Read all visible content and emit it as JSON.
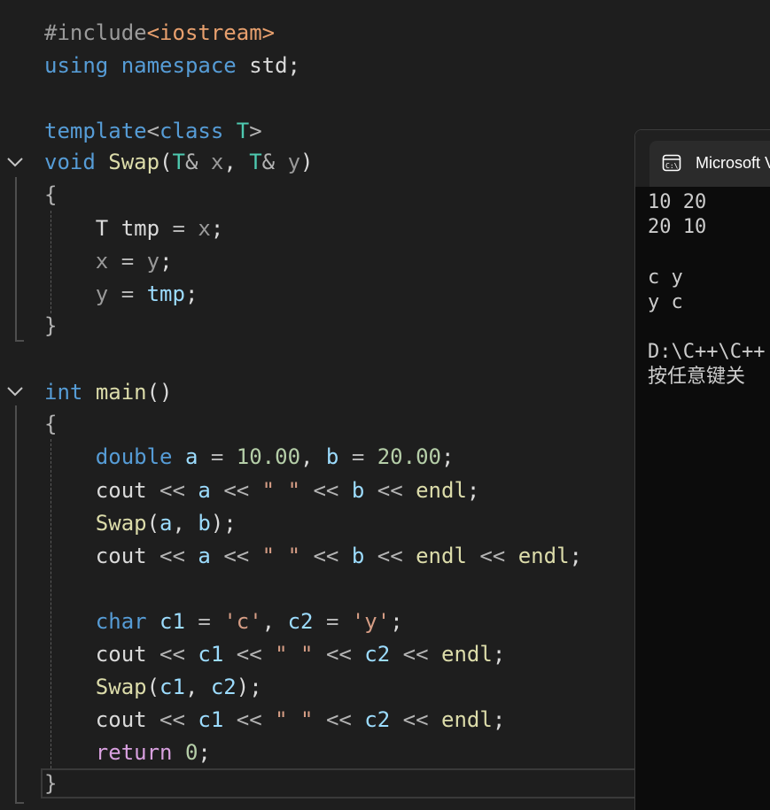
{
  "colors": {
    "editor_bg": "#1e1e1e",
    "keyword": "#569cd6",
    "type": "#4ec9b0",
    "function": "#dcdcaa",
    "variable": "#9cdcfe",
    "parameter": "#9a9a9a",
    "number": "#b5cea8",
    "string": "#d69d85",
    "control": "#d8a0df",
    "console_bg": "#0c0c0c",
    "console_text": "#cccccc"
  },
  "editor": {
    "lines": [
      [
        {
          "c": "t-pp",
          "t": "#include"
        },
        {
          "c": "t-inc",
          "t": "<iostream>"
        }
      ],
      [
        {
          "c": "t-kw",
          "t": "using namespace"
        },
        {
          "c": "t-def",
          "t": " std;"
        }
      ],
      [],
      [
        {
          "c": "t-kw",
          "t": "template"
        },
        {
          "c": "t-op",
          "t": "<"
        },
        {
          "c": "t-kw",
          "t": "class"
        },
        {
          "c": "t-def",
          "t": " "
        },
        {
          "c": "t-ty",
          "t": "T"
        },
        {
          "c": "t-op",
          "t": ">"
        }
      ],
      [
        {
          "c": "t-kw",
          "t": "void"
        },
        {
          "c": "t-def",
          "t": " "
        },
        {
          "c": "t-fn",
          "t": "Swap"
        },
        {
          "c": "t-def",
          "t": "("
        },
        {
          "c": "t-ty",
          "t": "T"
        },
        {
          "c": "t-op",
          "t": "&"
        },
        {
          "c": "t-def",
          "t": " "
        },
        {
          "c": "t-par",
          "t": "x"
        },
        {
          "c": "t-def",
          "t": ", "
        },
        {
          "c": "t-ty",
          "t": "T"
        },
        {
          "c": "t-op",
          "t": "&"
        },
        {
          "c": "t-def",
          "t": " "
        },
        {
          "c": "t-par",
          "t": "y"
        },
        {
          "c": "t-def",
          "t": ")"
        }
      ],
      [
        {
          "c": "t-op",
          "t": "{"
        }
      ],
      [
        {
          "c": "t-def",
          "t": "    T tmp "
        },
        {
          "c": "t-op",
          "t": "="
        },
        {
          "c": "t-def",
          "t": " "
        },
        {
          "c": "t-par",
          "t": "x"
        },
        {
          "c": "t-def",
          "t": ";"
        }
      ],
      [
        {
          "c": "t-def",
          "t": "    "
        },
        {
          "c": "t-par",
          "t": "x"
        },
        {
          "c": "t-def",
          "t": " "
        },
        {
          "c": "t-op",
          "t": "="
        },
        {
          "c": "t-def",
          "t": " "
        },
        {
          "c": "t-par",
          "t": "y"
        },
        {
          "c": "t-def",
          "t": ";"
        }
      ],
      [
        {
          "c": "t-def",
          "t": "    "
        },
        {
          "c": "t-par",
          "t": "y"
        },
        {
          "c": "t-def",
          "t": " "
        },
        {
          "c": "t-op",
          "t": "="
        },
        {
          "c": "t-def",
          "t": " "
        },
        {
          "c": "t-var",
          "t": "tmp"
        },
        {
          "c": "t-def",
          "t": ";"
        }
      ],
      [
        {
          "c": "t-op",
          "t": "}"
        }
      ],
      [],
      [
        {
          "c": "t-kw",
          "t": "int"
        },
        {
          "c": "t-def",
          "t": " "
        },
        {
          "c": "t-fn",
          "t": "main"
        },
        {
          "c": "t-def",
          "t": "()"
        }
      ],
      [
        {
          "c": "t-op",
          "t": "{"
        }
      ],
      [
        {
          "c": "t-def",
          "t": "    "
        },
        {
          "c": "t-kw",
          "t": "double"
        },
        {
          "c": "t-def",
          "t": " "
        },
        {
          "c": "t-var",
          "t": "a"
        },
        {
          "c": "t-def",
          "t": " "
        },
        {
          "c": "t-op",
          "t": "="
        },
        {
          "c": "t-def",
          "t": " "
        },
        {
          "c": "t-num",
          "t": "10.00"
        },
        {
          "c": "t-def",
          "t": ", "
        },
        {
          "c": "t-var",
          "t": "b"
        },
        {
          "c": "t-def",
          "t": " "
        },
        {
          "c": "t-op",
          "t": "="
        },
        {
          "c": "t-def",
          "t": " "
        },
        {
          "c": "t-num",
          "t": "20.00"
        },
        {
          "c": "t-def",
          "t": ";"
        }
      ],
      [
        {
          "c": "t-def",
          "t": "    cout "
        },
        {
          "c": "t-op",
          "t": "<<"
        },
        {
          "c": "t-def",
          "t": " "
        },
        {
          "c": "t-var",
          "t": "a"
        },
        {
          "c": "t-def",
          "t": " "
        },
        {
          "c": "t-op",
          "t": "<<"
        },
        {
          "c": "t-def",
          "t": " "
        },
        {
          "c": "t-str",
          "t": "\" \""
        },
        {
          "c": "t-def",
          "t": " "
        },
        {
          "c": "t-op",
          "t": "<<"
        },
        {
          "c": "t-def",
          "t": " "
        },
        {
          "c": "t-var",
          "t": "b"
        },
        {
          "c": "t-def",
          "t": " "
        },
        {
          "c": "t-op",
          "t": "<<"
        },
        {
          "c": "t-def",
          "t": " "
        },
        {
          "c": "t-fn",
          "t": "endl"
        },
        {
          "c": "t-def",
          "t": ";"
        }
      ],
      [
        {
          "c": "t-def",
          "t": "    "
        },
        {
          "c": "t-fn",
          "t": "Swap"
        },
        {
          "c": "t-def",
          "t": "("
        },
        {
          "c": "t-var",
          "t": "a"
        },
        {
          "c": "t-def",
          "t": ", "
        },
        {
          "c": "t-var",
          "t": "b"
        },
        {
          "c": "t-def",
          "t": ");"
        }
      ],
      [
        {
          "c": "t-def",
          "t": "    cout "
        },
        {
          "c": "t-op",
          "t": "<<"
        },
        {
          "c": "t-def",
          "t": " "
        },
        {
          "c": "t-var",
          "t": "a"
        },
        {
          "c": "t-def",
          "t": " "
        },
        {
          "c": "t-op",
          "t": "<<"
        },
        {
          "c": "t-def",
          "t": " "
        },
        {
          "c": "t-str",
          "t": "\" \""
        },
        {
          "c": "t-def",
          "t": " "
        },
        {
          "c": "t-op",
          "t": "<<"
        },
        {
          "c": "t-def",
          "t": " "
        },
        {
          "c": "t-var",
          "t": "b"
        },
        {
          "c": "t-def",
          "t": " "
        },
        {
          "c": "t-op",
          "t": "<<"
        },
        {
          "c": "t-def",
          "t": " "
        },
        {
          "c": "t-fn",
          "t": "endl"
        },
        {
          "c": "t-def",
          "t": " "
        },
        {
          "c": "t-op",
          "t": "<<"
        },
        {
          "c": "t-def",
          "t": " "
        },
        {
          "c": "t-fn",
          "t": "endl"
        },
        {
          "c": "t-def",
          "t": ";"
        }
      ],
      [],
      [
        {
          "c": "t-def",
          "t": "    "
        },
        {
          "c": "t-kw",
          "t": "char"
        },
        {
          "c": "t-def",
          "t": " "
        },
        {
          "c": "t-var",
          "t": "c1"
        },
        {
          "c": "t-def",
          "t": " "
        },
        {
          "c": "t-op",
          "t": "="
        },
        {
          "c": "t-def",
          "t": " "
        },
        {
          "c": "t-str",
          "t": "'c'"
        },
        {
          "c": "t-def",
          "t": ", "
        },
        {
          "c": "t-var",
          "t": "c2"
        },
        {
          "c": "t-def",
          "t": " "
        },
        {
          "c": "t-op",
          "t": "="
        },
        {
          "c": "t-def",
          "t": " "
        },
        {
          "c": "t-str",
          "t": "'y'"
        },
        {
          "c": "t-def",
          "t": ";"
        }
      ],
      [
        {
          "c": "t-def",
          "t": "    cout "
        },
        {
          "c": "t-op",
          "t": "<<"
        },
        {
          "c": "t-def",
          "t": " "
        },
        {
          "c": "t-var",
          "t": "c1"
        },
        {
          "c": "t-def",
          "t": " "
        },
        {
          "c": "t-op",
          "t": "<<"
        },
        {
          "c": "t-def",
          "t": " "
        },
        {
          "c": "t-str",
          "t": "\" \""
        },
        {
          "c": "t-def",
          "t": " "
        },
        {
          "c": "t-op",
          "t": "<<"
        },
        {
          "c": "t-def",
          "t": " "
        },
        {
          "c": "t-var",
          "t": "c2"
        },
        {
          "c": "t-def",
          "t": " "
        },
        {
          "c": "t-op",
          "t": "<<"
        },
        {
          "c": "t-def",
          "t": " "
        },
        {
          "c": "t-fn",
          "t": "endl"
        },
        {
          "c": "t-def",
          "t": ";"
        }
      ],
      [
        {
          "c": "t-def",
          "t": "    "
        },
        {
          "c": "t-fn",
          "t": "Swap"
        },
        {
          "c": "t-def",
          "t": "("
        },
        {
          "c": "t-var",
          "t": "c1"
        },
        {
          "c": "t-def",
          "t": ", "
        },
        {
          "c": "t-var",
          "t": "c2"
        },
        {
          "c": "t-def",
          "t": ");"
        }
      ],
      [
        {
          "c": "t-def",
          "t": "    cout "
        },
        {
          "c": "t-op",
          "t": "<<"
        },
        {
          "c": "t-def",
          "t": " "
        },
        {
          "c": "t-var",
          "t": "c1"
        },
        {
          "c": "t-def",
          "t": " "
        },
        {
          "c": "t-op",
          "t": "<<"
        },
        {
          "c": "t-def",
          "t": " "
        },
        {
          "c": "t-str",
          "t": "\" \""
        },
        {
          "c": "t-def",
          "t": " "
        },
        {
          "c": "t-op",
          "t": "<<"
        },
        {
          "c": "t-def",
          "t": " "
        },
        {
          "c": "t-var",
          "t": "c2"
        },
        {
          "c": "t-def",
          "t": " "
        },
        {
          "c": "t-op",
          "t": "<<"
        },
        {
          "c": "t-def",
          "t": " "
        },
        {
          "c": "t-fn",
          "t": "endl"
        },
        {
          "c": "t-def",
          "t": ";"
        }
      ],
      [
        {
          "c": "t-def",
          "t": "    "
        },
        {
          "c": "t-ctl",
          "t": "return"
        },
        {
          "c": "t-def",
          "t": " "
        },
        {
          "c": "t-num",
          "t": "0"
        },
        {
          "c": "t-def",
          "t": ";"
        }
      ],
      [
        {
          "c": "t-op",
          "t": "}"
        }
      ]
    ]
  },
  "console": {
    "title": "Microsoft Visual Studio",
    "output": [
      "10 20",
      "20 10",
      "",
      "c y",
      "y c",
      "",
      "D:\\C++\\C++",
      "按任意键关"
    ]
  }
}
